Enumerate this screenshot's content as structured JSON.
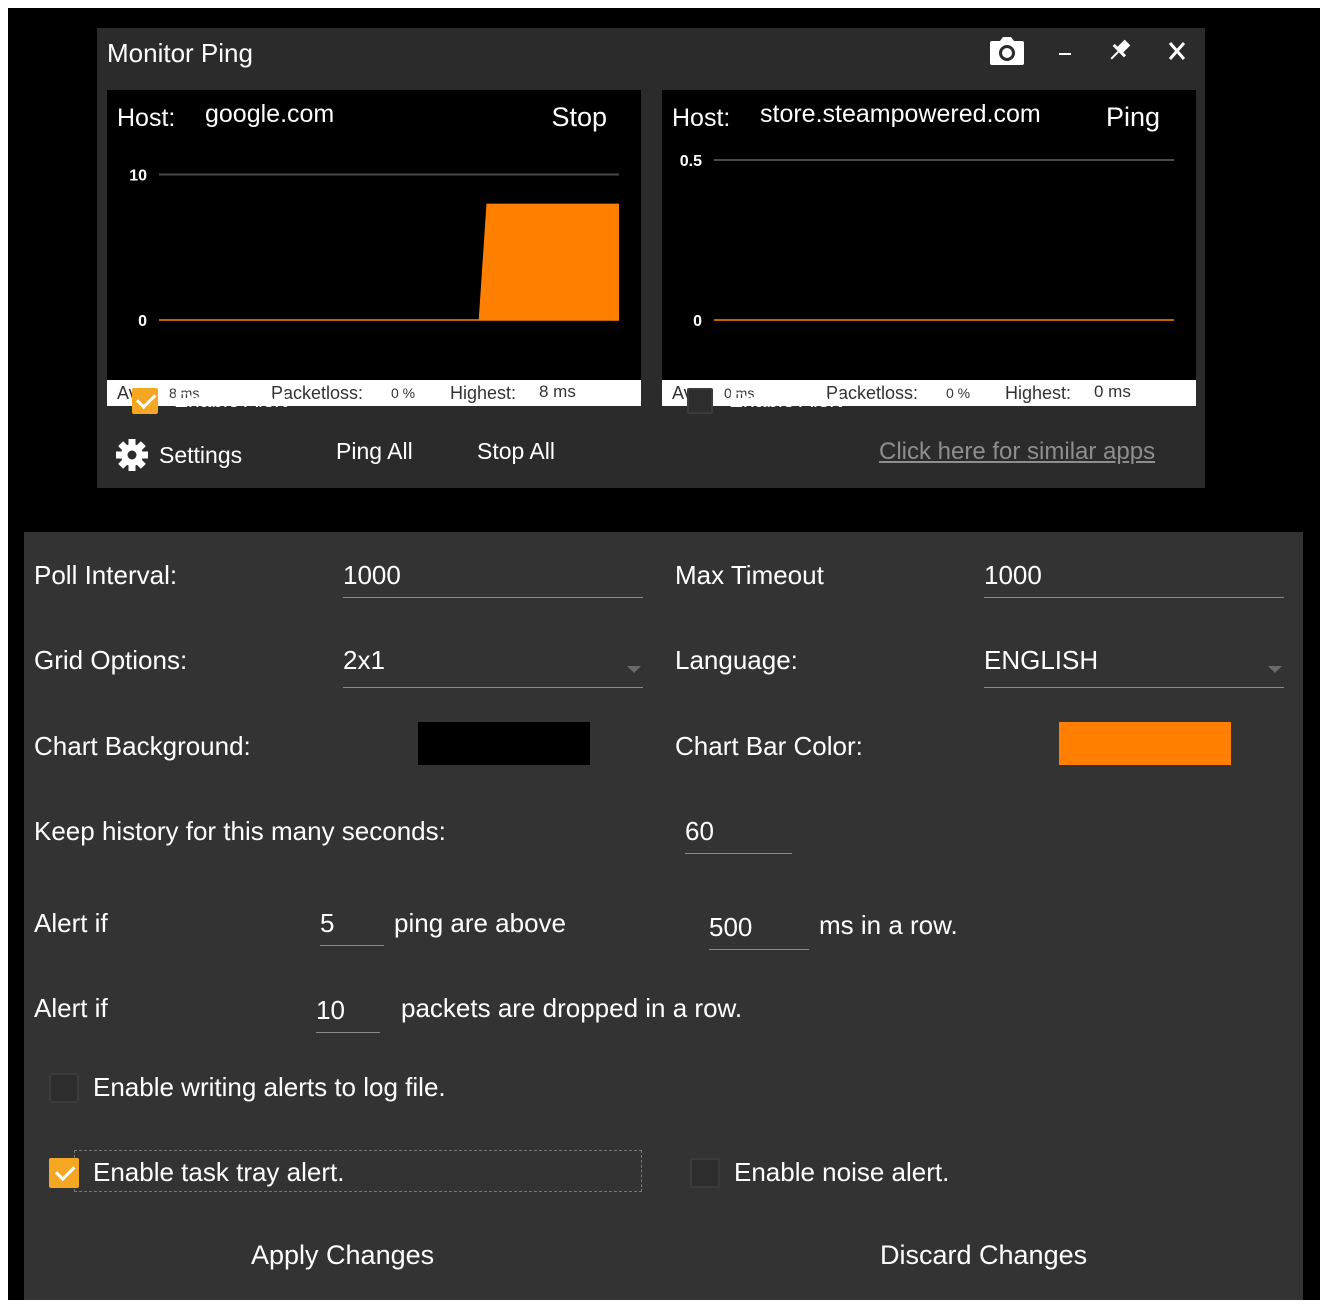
{
  "window": {
    "title": "Monitor Ping"
  },
  "panels": [
    {
      "host_label": "Host:",
      "host": "google.com",
      "action": "Stop",
      "chart_data": {
        "type": "area",
        "yticks": [
          0,
          10
        ],
        "ylim": [
          0,
          11
        ],
        "series": [
          {
            "values": [
              0,
              0,
              0,
              0,
              0,
              0,
              0,
              0,
              0,
              0,
              0,
              0,
              0,
              0,
              0,
              0,
              0,
              0,
              0,
              0,
              0,
              0,
              0,
              0,
              0,
              0,
              0,
              0,
              0,
              0,
              0,
              0,
              0,
              0,
              0,
              0,
              0,
              0,
              0,
              0,
              0,
              0,
              8,
              8,
              8,
              8,
              8,
              8,
              8,
              8,
              8,
              8,
              8,
              8,
              8,
              8,
              8,
              8,
              8,
              8
            ]
          }
        ]
      },
      "stats": {
        "avg_label": "Avg:",
        "avg": "8 ms",
        "loss_label": "Packetloss:",
        "loss": "0 %",
        "high_label": "Highest:",
        "high": "8 ms"
      },
      "alert_label": "Enable Alert",
      "alert_checked": true
    },
    {
      "host_label": "Host:",
      "host": "store.steampowered.com",
      "action": "Ping",
      "chart_data": {
        "type": "area",
        "yticks": [
          0,
          0.5
        ],
        "ylim": [
          0,
          0.5
        ],
        "series": [
          {
            "values": []
          }
        ]
      },
      "stats": {
        "avg_label": "Avg:",
        "avg": "0 ms",
        "loss_label": "Packetloss:",
        "loss": "0 %",
        "high_label": "Highest:",
        "high": "0 ms"
      },
      "alert_label": "Enable Alert",
      "alert_checked": false
    }
  ],
  "footer": {
    "settings": "Settings",
    "ping_all": "Ping All",
    "stop_all": "Stop All",
    "similar": "Click here for similar apps"
  },
  "settings": {
    "poll_interval_label": "Poll Interval:",
    "poll_interval": "1000",
    "max_timeout_label": "Max Timeout",
    "max_timeout": "1000",
    "grid_options_label": "Grid Options:",
    "grid_options": "2x1",
    "language_label": "Language:",
    "language": "ENGLISH",
    "chart_background_label": "Chart Background:",
    "chart_background_color": "#000000",
    "chart_bar_color_label": "Chart Bar Color:",
    "chart_bar_color": "#ff8000",
    "history_label": "Keep history for this many seconds:",
    "history": "60",
    "alert_if_1": "Alert if",
    "ping_count": "5",
    "ping_above": "ping are above",
    "ping_ms": "500",
    "ms_in_row": "ms in a row.",
    "alert_if_2": "Alert if",
    "packets_count": "10",
    "packets_dropped": "packets are dropped in a row.",
    "log_file_label": "Enable writing alerts to log file.",
    "log_file_checked": false,
    "task_tray_label": "Enable task tray alert.",
    "task_tray_checked": true,
    "noise_label": "Enable noise alert.",
    "noise_checked": false,
    "apply": "Apply Changes",
    "discard": "Discard Changes"
  },
  "colors": {
    "accent": "#f5a623",
    "bar": "#ff8000",
    "panel": "#2b2b2b",
    "settings_bg": "#333333"
  }
}
